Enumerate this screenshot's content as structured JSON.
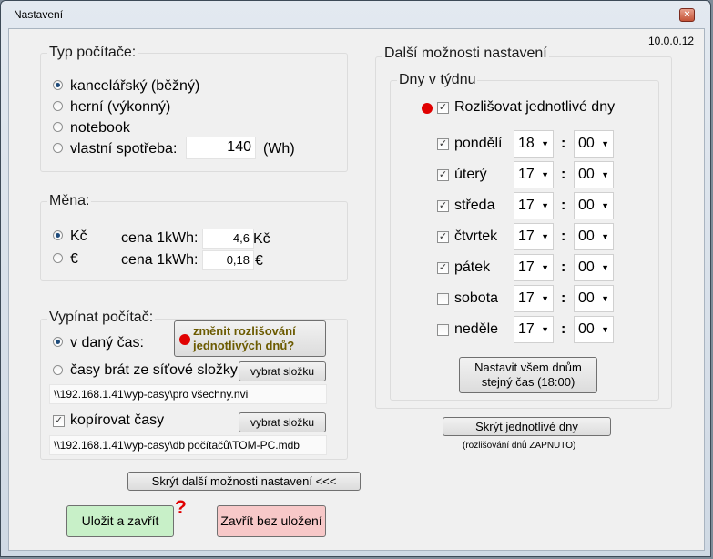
{
  "window": {
    "title": "Nastavení",
    "version": "10.0.0.12",
    "close_symbol": "×"
  },
  "computer_type": {
    "title": "Typ počítače:",
    "options": [
      "kancelářský (běžný)",
      "herní (výkonný)",
      "notebook",
      "vlastní spotřeba:"
    ],
    "selected": "kancelářský (běžný)",
    "custom_value": "140",
    "custom_unit": "(Wh)"
  },
  "currency": {
    "title": "Měna:",
    "rows": [
      {
        "option": "Kč",
        "price_label": "cena 1kWh:",
        "price": "4,6",
        "unit": "Kč",
        "selected": true
      },
      {
        "option": "€",
        "price_label": "cena 1kWh:",
        "price": "0,18",
        "unit": "€",
        "selected": false
      }
    ]
  },
  "shutdown": {
    "title": "Vypínat počítač:",
    "option_time": "v daný čas:",
    "option_network": "časy brát ze síťové složky",
    "hint_button": "změnit rozlišování\njednotlivých dnů?",
    "select_folder": "vybrat složku",
    "network_path": "\\\\192.168.1.41\\vyp-casy\\pro všechny.nvi",
    "copy_label": "kopírovat časy",
    "copy_checked": true,
    "copy_path": "\\\\192.168.1.41\\vyp-casy\\db počítačů\\TOM-PC.mdb"
  },
  "more_options": {
    "title": "Další možnosti nastavení",
    "days_title": "Dny v týdnu",
    "distinguish_label": "Rozlišovat jednotlivé dny",
    "days": [
      {
        "name": "pondělí",
        "checked": true,
        "hour": "18",
        "minute": "00"
      },
      {
        "name": "úterý",
        "checked": true,
        "hour": "17",
        "minute": "00"
      },
      {
        "name": "středa",
        "checked": true,
        "hour": "17",
        "minute": "00"
      },
      {
        "name": "čtvrtek",
        "checked": true,
        "hour": "17",
        "minute": "00"
      },
      {
        "name": "pátek",
        "checked": true,
        "hour": "17",
        "minute": "00"
      },
      {
        "name": "sobota",
        "checked": false,
        "hour": "17",
        "minute": "00"
      },
      {
        "name": "neděle",
        "checked": false,
        "hour": "17",
        "minute": "00"
      }
    ],
    "colon": ":",
    "set_all_button": "Nastavit všem dnům\nstejný čas (18:00)",
    "hide_days_button": "Skrýt jednotlivé dny",
    "status_text": "(rozlišování dnů ZAPNUTO)"
  },
  "footer": {
    "hide_more_button": "Skrýt další možnosti nastavení <<<",
    "save_button": "Uložit a zavřít",
    "question_mark": "?",
    "cancel_button": "Zavřít bez uložení",
    "save_color": "#c8f0c8",
    "cancel_color": "#f7c8c8"
  },
  "colors": {
    "red_dot": "#e00000",
    "hint_text": "#6b5a00",
    "question_mark": "#e00000"
  }
}
